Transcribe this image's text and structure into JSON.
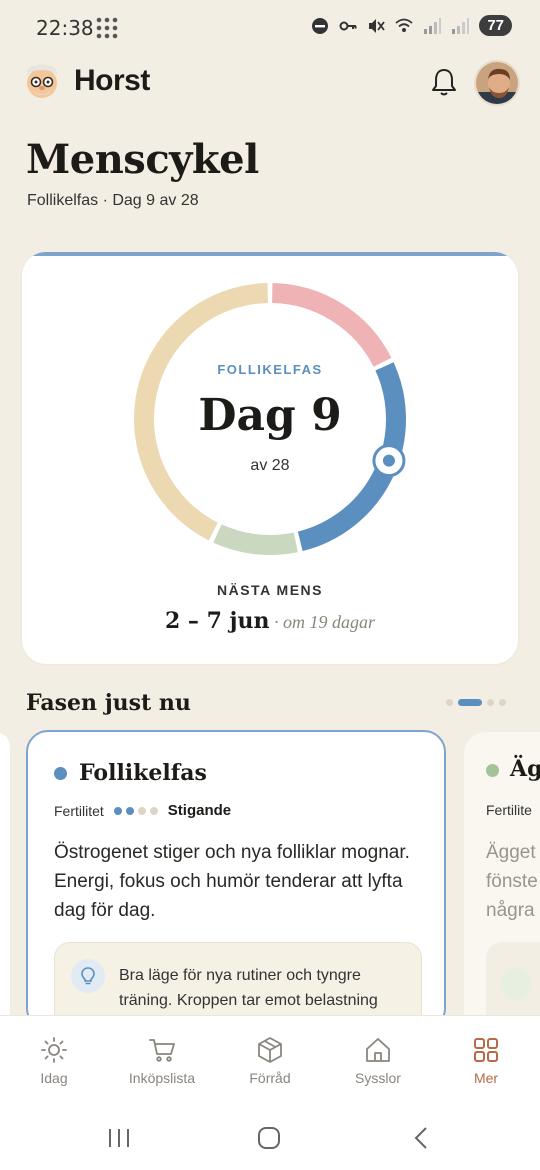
{
  "status_bar": {
    "time": "22:38",
    "battery": "77"
  },
  "header": {
    "app_name": "Horst"
  },
  "page": {
    "title": "Menscykel",
    "subtitle": "Follikelfas · Dag 9 av 28"
  },
  "cycle": {
    "phase_label": "FOLLIKELFAS",
    "day_text": "Dag 9",
    "of_text": "av 28",
    "current_day": 9,
    "cycle_length": 28,
    "next_label": "NÄSTA MENS",
    "next_dates": "2 – 7 jun",
    "next_in": " · om 19 dagar",
    "colors": {
      "menstrual": "#efb3b6",
      "follicular": "#5b8fc0",
      "ovulation": "#c9d8bf",
      "luteal": "#ecd9b1"
    }
  },
  "phase_section": {
    "title": "Fasen just nu",
    "current_page": 2,
    "page_count": 4,
    "card": {
      "name": "Follikelfas",
      "fertility_label": "Fertilitet",
      "fertility_level": 2,
      "fertility_max": 4,
      "fertility_value": "Stigande",
      "description": "Östrogenet stiger och nya folliklar mognar. Energi, fokus och humör tenderar att lyfta dag för dag.",
      "tip": "Bra läge för nya rutiner och tyngre träning. Kroppen tar emot belastning"
    },
    "next_card": {
      "name": "Äg",
      "fertility_label": "Fertilite",
      "description_lines": [
        "Ägget",
        "fönste",
        "några"
      ]
    }
  },
  "bottom_nav": [
    {
      "label": "Idag",
      "icon": "sun-icon"
    },
    {
      "label": "Inköpslista",
      "icon": "cart-icon"
    },
    {
      "label": "Förråd",
      "icon": "box-icon"
    },
    {
      "label": "Sysslor",
      "icon": "home-icon"
    },
    {
      "label": "Mer",
      "icon": "grid-icon",
      "active": true
    }
  ]
}
